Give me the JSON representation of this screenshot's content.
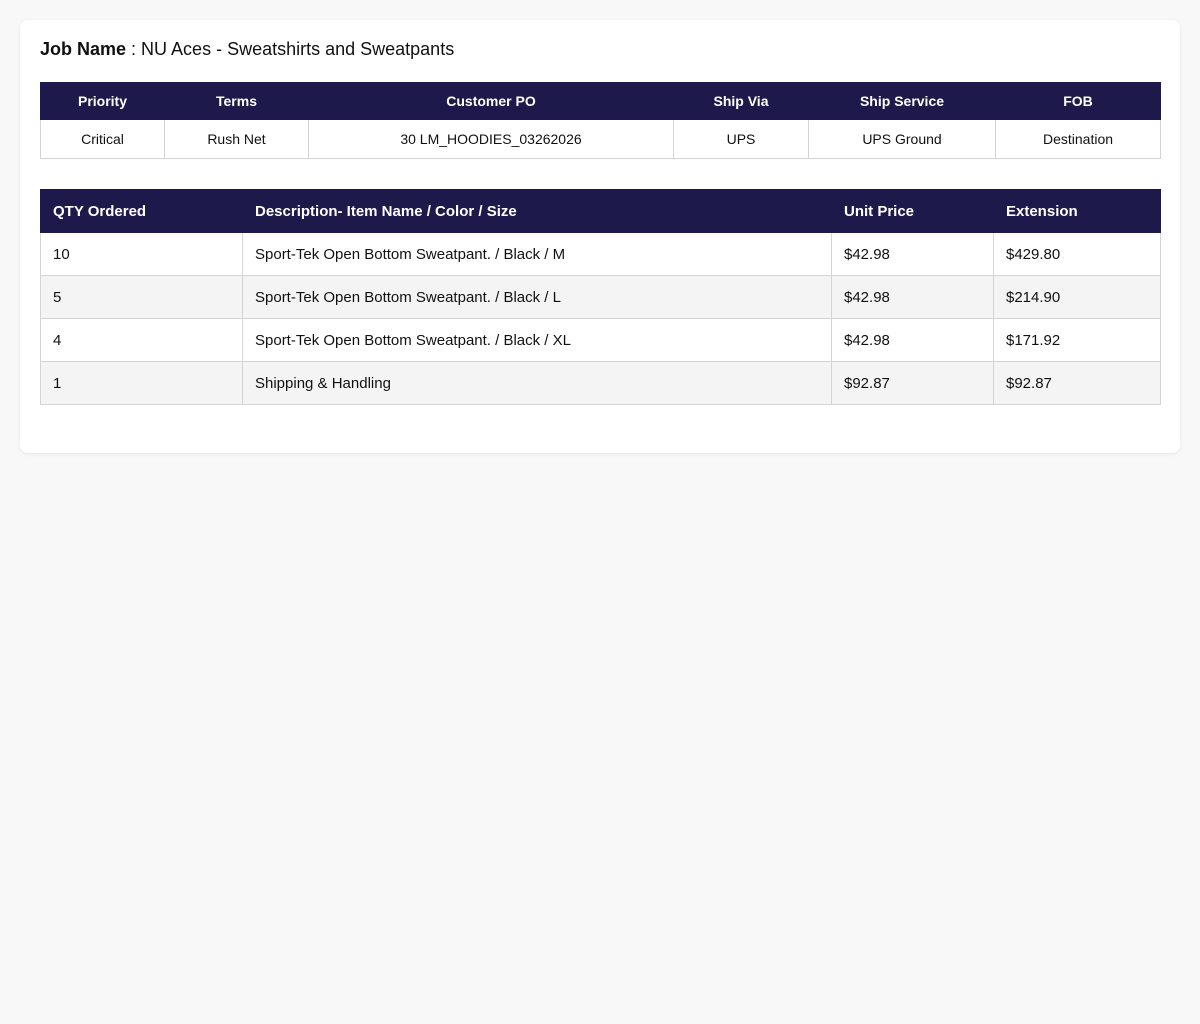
{
  "job": {
    "label": "Job Name",
    "separator": " : ",
    "value": "NU Aces - Sweatshirts and Sweatpants"
  },
  "order_meta": {
    "headers": [
      "Priority",
      "Terms",
      "Customer PO",
      "Ship Via",
      "Ship Service",
      "FOB"
    ],
    "values": [
      "Critical",
      "Rush Net",
      "30 LM_HOODIES_03262026",
      "UPS",
      "UPS Ground",
      "Destination"
    ]
  },
  "line_items": {
    "headers": [
      "QTY Ordered",
      "Description- Item Name / Color / Size",
      "Unit Price",
      "Extension"
    ],
    "rows": [
      {
        "qty": "10",
        "description": "Sport-Tek Open Bottom Sweatpant. / Black / M",
        "unit_price": "$42.98",
        "extension": "$429.80"
      },
      {
        "qty": "5",
        "description": "Sport-Tek Open Bottom Sweatpant. / Black / L",
        "unit_price": "$42.98",
        "extension": "$214.90"
      },
      {
        "qty": "4",
        "description": "Sport-Tek Open Bottom Sweatpant. / Black / XL",
        "unit_price": "$42.98",
        "extension": "$171.92"
      },
      {
        "qty": "1",
        "description": "Shipping & Handling",
        "unit_price": "$92.87",
        "extension": "$92.87"
      }
    ]
  },
  "colors": {
    "header_bg": "#1d1a4b",
    "header_text": "#ffffff",
    "stripe_bg": "#f4f4f4",
    "page_bg": "#f8f8f8"
  }
}
